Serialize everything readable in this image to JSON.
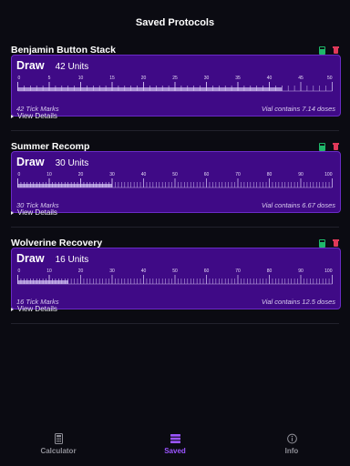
{
  "header": {
    "title": "Saved Protocols"
  },
  "protocols": [
    {
      "name": "Benjamin Button Stack",
      "draw_label": "Draw",
      "units_text": "42 Units",
      "units": 42,
      "scale_max": 50,
      "tick_labels": [
        "0",
        "5",
        "10",
        "15",
        "20",
        "25",
        "30",
        "35",
        "40",
        "45",
        "50"
      ],
      "tick_marks_text": "42 Tick Marks",
      "vial_text": "Vial contains 7.14 doses",
      "details_label": "View Details"
    },
    {
      "name": "Summer Recomp",
      "draw_label": "Draw",
      "units_text": "30 Units",
      "units": 30,
      "scale_max": 100,
      "tick_labels": [
        "0",
        "10",
        "20",
        "30",
        "40",
        "50",
        "60",
        "70",
        "80",
        "90",
        "100"
      ],
      "tick_marks_text": "30 Tick Marks",
      "vial_text": "Vial contains 6.67 doses",
      "details_label": "View Details"
    },
    {
      "name": "Wolverine Recovery",
      "draw_label": "Draw",
      "units_text": "16 Units",
      "units": 16,
      "scale_max": 100,
      "tick_labels": [
        "0",
        "10",
        "20",
        "30",
        "40",
        "50",
        "60",
        "70",
        "80",
        "90",
        "100"
      ],
      "tick_marks_text": "16 Tick Marks",
      "vial_text": "Vial contains 12.5 doses",
      "details_label": "View Details"
    }
  ],
  "tabs": [
    {
      "label": "Calculator",
      "icon": "calculator-icon",
      "active": false
    },
    {
      "label": "Saved",
      "icon": "list-icon",
      "active": true
    },
    {
      "label": "Info",
      "icon": "info-icon",
      "active": false
    }
  ],
  "colors": {
    "background": "#0b0b12",
    "card": "#3f0a86",
    "accent": "#9b55ff",
    "calc_icon": "#1fb86a",
    "delete_icon": "#e0395a"
  }
}
